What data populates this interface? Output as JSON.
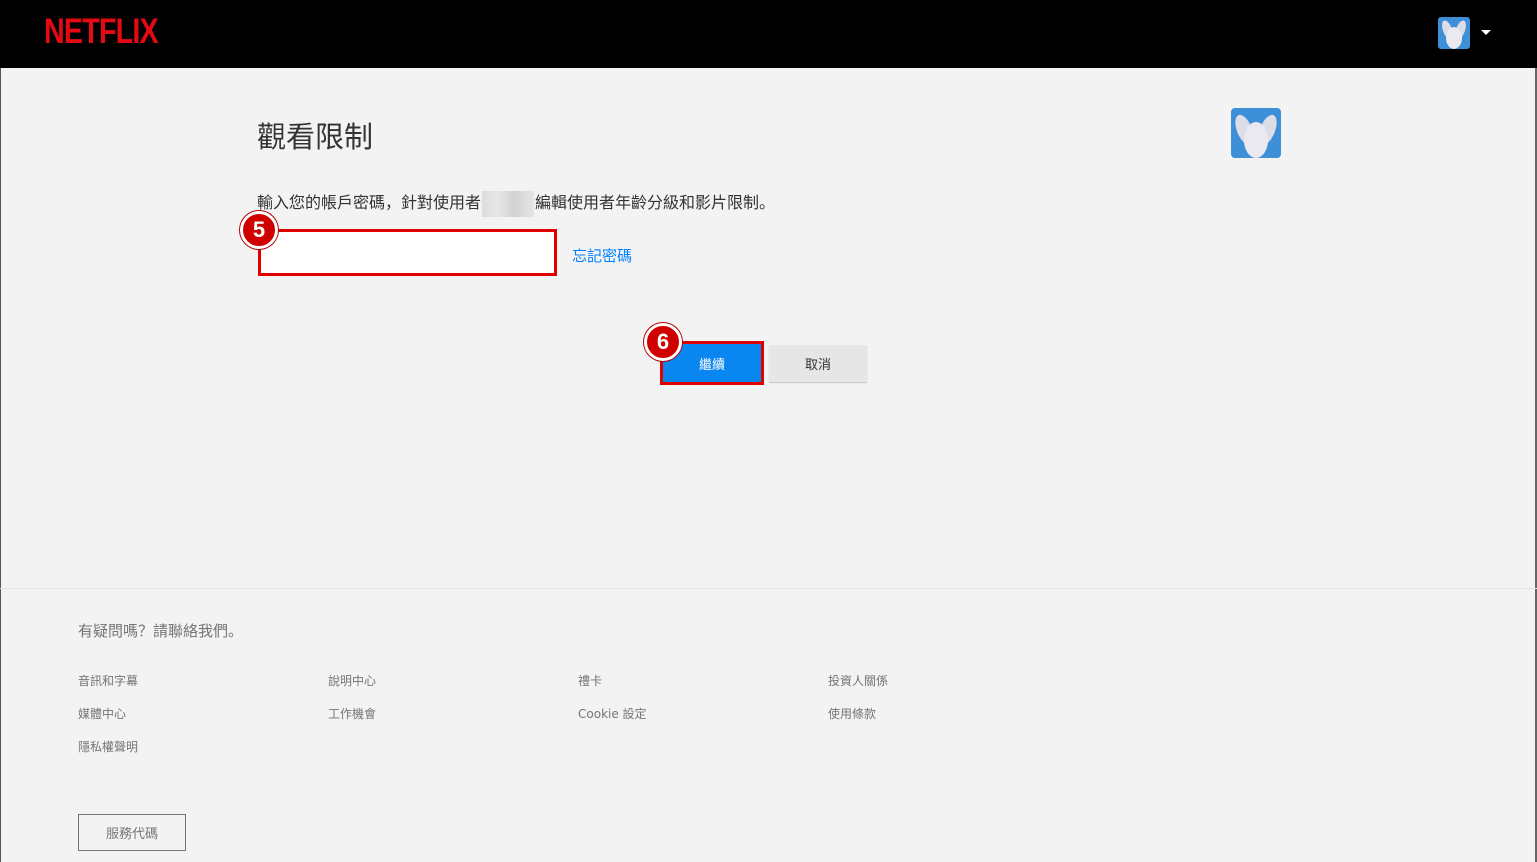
{
  "header": {
    "logo_text": "NETFLIX"
  },
  "main": {
    "title": "觀看限制",
    "instruction_before": "輸入您的帳戶密碼，針對使用者",
    "instruction_after": "編輯使用者年齡分級和影片限制。",
    "password_value": "",
    "forgot_link": "忘記密碼",
    "continue_label": "繼續",
    "cancel_label": "取消"
  },
  "annotations": {
    "step_input": "5",
    "step_button": "6"
  },
  "footer": {
    "questions": "有疑問嗎？請聯絡我們。",
    "links": [
      "音訊和字幕",
      "說明中心",
      "禮卡",
      "投資人關係",
      "媒體中心",
      "工作機會",
      "Cookie 設定",
      "使用條款",
      "隱私權聲明"
    ],
    "service_code_label": "服務代碼"
  },
  "colors": {
    "brand": "#e50914",
    "accent": "#0a86f0",
    "annotation": "#e00000"
  },
  "icons": {
    "profile": "bunny-avatar-icon",
    "dropdown": "caret-down-icon"
  }
}
